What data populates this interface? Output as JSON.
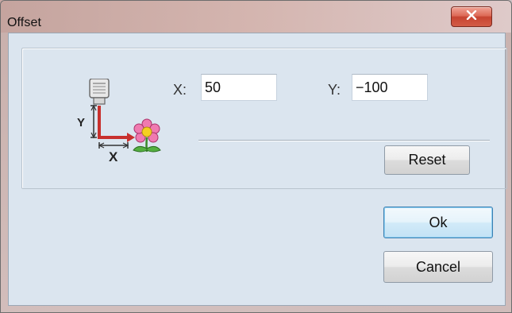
{
  "window": {
    "title": "Offset",
    "close_icon": "close-x-icon",
    "close_button_color": "#d35b46"
  },
  "offset": {
    "x_label": "X:",
    "x_value": "50",
    "y_label": "Y:",
    "y_value": "−100",
    "reset_label": "Reset",
    "icon": "offset-diagram-icon",
    "icon_axis_v": "Y",
    "icon_axis_h": "X"
  },
  "footer": {
    "ok_label": "Ok",
    "cancel_label": "Cancel"
  },
  "colors": {
    "dialog_bg": "#dbe5ef",
    "arrow": "#c8302d",
    "default_button_border": "#3c7fb1"
  }
}
